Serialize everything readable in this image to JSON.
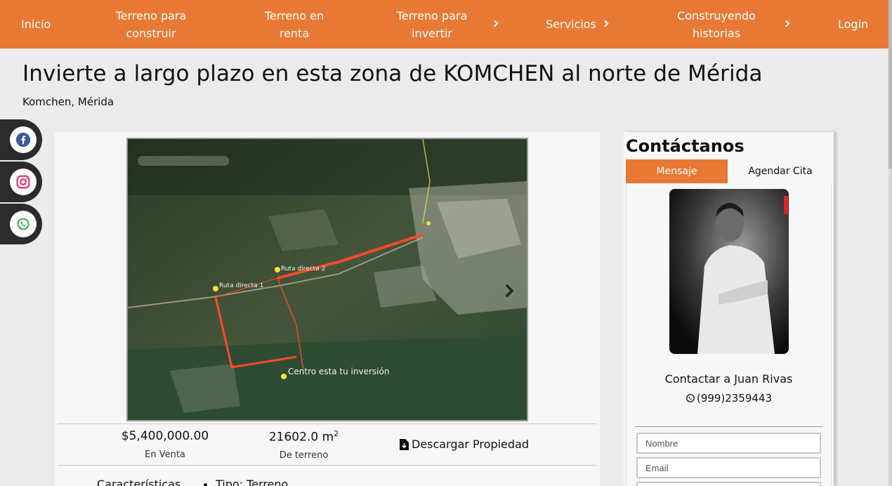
{
  "nav": {
    "items": [
      {
        "label": "Inicio"
      },
      {
        "label": "Terreno para construir"
      },
      {
        "label": "Terreno en renta"
      },
      {
        "label": "Terreno para invertir"
      },
      {
        "label": "Servicios"
      },
      {
        "label": "Construyendo historias"
      },
      {
        "label": "Login"
      }
    ]
  },
  "page": {
    "title": "Invierte a largo plazo en esta zona de KOMCHEN al norte de Mérida",
    "location": "Komchen, Mérida"
  },
  "social": [
    {
      "icon": "facebook-icon"
    },
    {
      "icon": "instagram-icon"
    },
    {
      "icon": "whatsapp-icon"
    }
  ],
  "map": {
    "labels": [
      "Ruta directa 1",
      "Ruta directa 2",
      "Centro esta tu inversión"
    ]
  },
  "stats": {
    "price": "$5,400,000.00",
    "price_label": "En Venta",
    "area": "21602.0 m",
    "area_sup": "2",
    "area_label": "De terreno",
    "download": "Descargar Propiedad"
  },
  "features": {
    "heading": "Características",
    "type": "Tipo: Terreno"
  },
  "contact": {
    "title": "Contáctanos",
    "tab_message": "Mensaje",
    "tab_appointment": "Agendar Cita",
    "name": "Contactar a Juan Rivas",
    "phone": "(999)2359443",
    "placeholder_name": "Nombre",
    "placeholder_email": "Email"
  },
  "colors": {
    "accent": "#e77935",
    "dark": "#2b2b2b"
  }
}
